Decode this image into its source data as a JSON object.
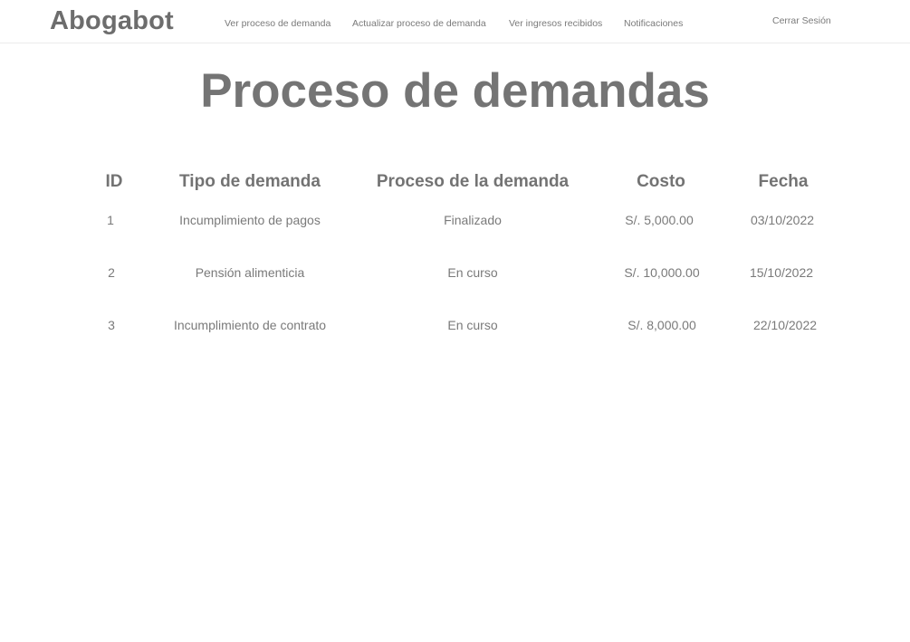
{
  "brand": "Abogabot",
  "nav": {
    "items": [
      {
        "label": "Ver proceso de demanda"
      },
      {
        "label": "Actualizar proceso de demanda"
      },
      {
        "label": "Ver ingresos recibidos"
      },
      {
        "label": "Notificaciones"
      }
    ],
    "logout_label": "Cerrar Sesión"
  },
  "page": {
    "title": "Proceso de demandas"
  },
  "table": {
    "headers": [
      "ID",
      "Tipo de demanda",
      "Proceso de la demanda",
      "Costo",
      "Fecha"
    ],
    "rows": [
      [
        "1",
        "Incumplimiento de pagos",
        "Finalizado",
        "S/. 5,000.00",
        "03/10/2022"
      ],
      [
        "2",
        "Pensión alimenticia",
        "En curso",
        "S/. 10,000.00",
        "15/10/2022"
      ],
      [
        "3",
        "Incumplimiento de contrato",
        "En curso",
        "S/. 8,000.00",
        "22/10/2022"
      ]
    ]
  }
}
